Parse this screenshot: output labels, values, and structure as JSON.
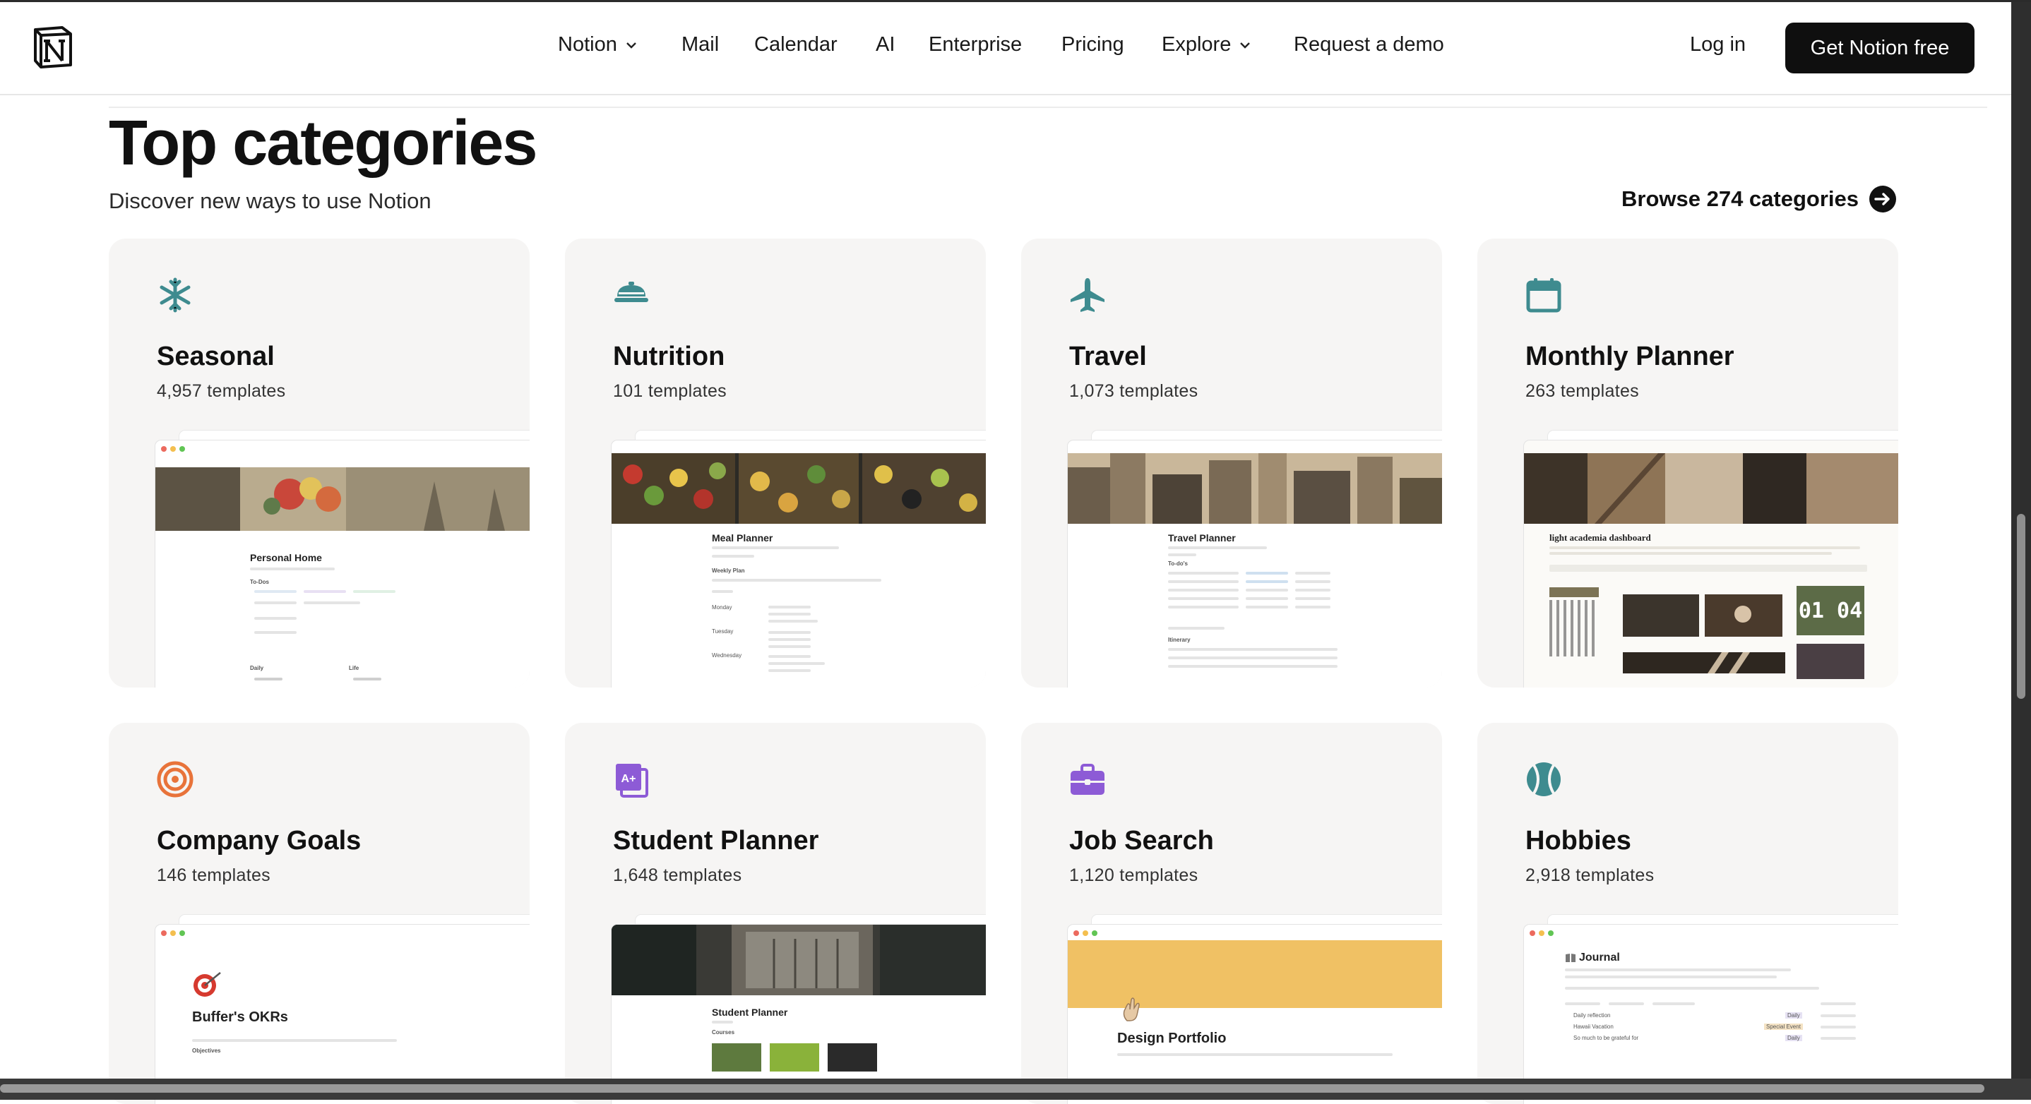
{
  "header": {
    "nav": [
      "Notion",
      "Mail",
      "Calendar",
      "AI",
      "Enterprise",
      "Pricing",
      "Explore",
      "Request a demo"
    ],
    "login": "Log in",
    "cta": "Get Notion free"
  },
  "section": {
    "title": "Top categories",
    "subtitle": "Discover new ways to use Notion",
    "browse": "Browse 274 categories"
  },
  "categories": [
    {
      "name": "Seasonal",
      "count": "4,957 templates",
      "icon": "snowflake-icon",
      "color": "#3e8b8f",
      "preview_title": "Personal Home"
    },
    {
      "name": "Nutrition",
      "count": "101 templates",
      "icon": "food-cloche-icon",
      "color": "#3e8b8f",
      "preview_title": "Meal Planner"
    },
    {
      "name": "Travel",
      "count": "1,073 templates",
      "icon": "airplane-icon",
      "color": "#3e8b8f",
      "preview_title": "Travel Planner"
    },
    {
      "name": "Monthly Planner",
      "count": "263 templates",
      "icon": "calendar-icon",
      "color": "#3e8b8f",
      "preview_title": "light academia dashboard"
    },
    {
      "name": "Company Goals",
      "count": "146 templates",
      "icon": "target-icon",
      "color": "#e8733a",
      "preview_title": "Buffer's OKRs"
    },
    {
      "name": "Student Planner",
      "count": "1,648 templates",
      "icon": "grade-book-icon",
      "color": "#8d5bd6",
      "preview_title": "Student Planner"
    },
    {
      "name": "Job Search",
      "count": "1,120 templates",
      "icon": "briefcase-icon",
      "color": "#8d5bd6",
      "preview_title": "Design Portfolio"
    },
    {
      "name": "Hobbies",
      "count": "2,918 templates",
      "icon": "tennis-ball-icon",
      "color": "#3e8b8f",
      "preview_title": "Journal"
    }
  ],
  "previews": {
    "seasonal": {
      "todos": "To-Dos",
      "daily": "Daily",
      "life": "Life"
    },
    "nutrition": {
      "weekly": "Weekly Plan",
      "days": [
        "Monday",
        "Tuesday",
        "Wednesday"
      ]
    },
    "travel": {
      "todos": "To-do's",
      "itinerary": "Itinerary"
    },
    "monthly": {
      "clock": "01 04"
    },
    "goals": {
      "objectives": "Objectives"
    },
    "student": {
      "courses": "Courses"
    },
    "hobbies": {
      "entries": [
        "Daily reflection",
        "Hawaii Vacation",
        "So much to be grateful for"
      ],
      "tags": [
        "Daily",
        "Special Event",
        "Daily"
      ]
    }
  }
}
